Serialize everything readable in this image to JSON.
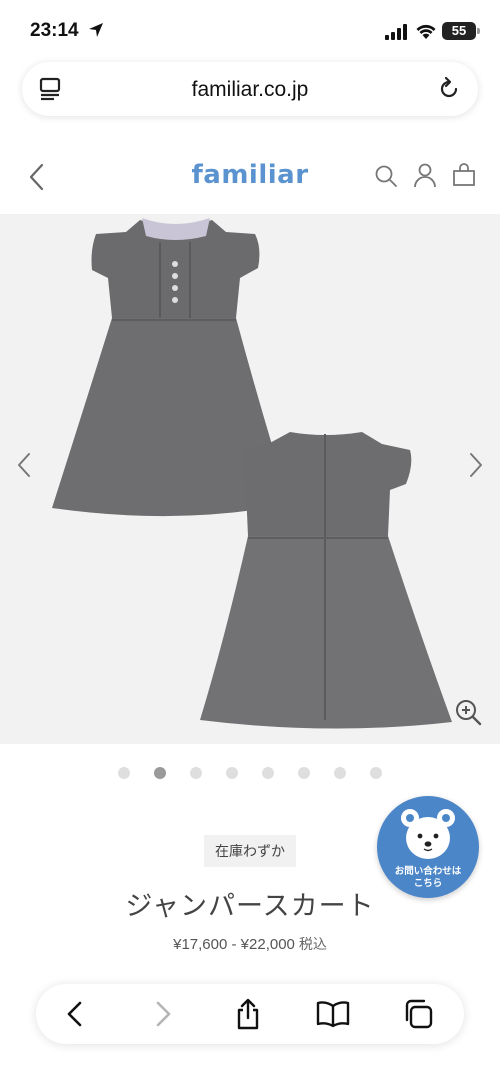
{
  "status_bar": {
    "time": "23:14",
    "battery": "55"
  },
  "browser": {
    "url": "familiar.co.jp"
  },
  "site": {
    "logo": "familiar"
  },
  "gallery": {
    "total_images": 8,
    "active_index": 1
  },
  "product": {
    "stock_badge": "在庫わずか",
    "title": "ジャンパースカート",
    "price": "¥17,600 - ¥22,000",
    "tax_label": "税込"
  },
  "contact": {
    "line1": "お問い合わせは",
    "line2": "こちら"
  },
  "colors": {
    "brand": "#5a93cf",
    "contact_bg": "#4a86c8",
    "gallery_bg": "#f2f2f2"
  }
}
